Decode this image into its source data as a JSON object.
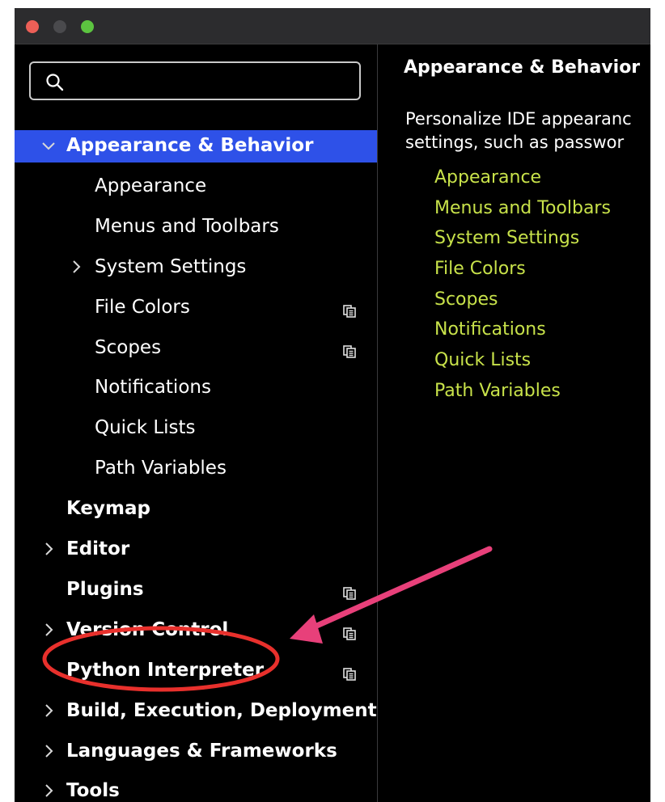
{
  "search": {
    "placeholder": "",
    "value": ""
  },
  "sidebar": {
    "items": [
      {
        "label": "Appearance & Behavior",
        "level": 1,
        "expanded": true,
        "selected": true,
        "project": false
      },
      {
        "label": "Appearance",
        "level": 2,
        "project": false
      },
      {
        "label": "Menus and Toolbars",
        "level": 2,
        "project": false
      },
      {
        "label": "System Settings",
        "level": 2,
        "expandable": true,
        "project": false
      },
      {
        "label": "File Colors",
        "level": 2,
        "project": true
      },
      {
        "label": "Scopes",
        "level": 2,
        "project": true
      },
      {
        "label": "Notifications",
        "level": 2,
        "project": false
      },
      {
        "label": "Quick Lists",
        "level": 2,
        "project": false
      },
      {
        "label": "Path Variables",
        "level": 2,
        "project": false
      },
      {
        "label": "Keymap",
        "level": 1,
        "project": false
      },
      {
        "label": "Editor",
        "level": 1,
        "expandable": true,
        "project": false
      },
      {
        "label": "Plugins",
        "level": 1,
        "project": true
      },
      {
        "label": "Version Control",
        "level": 1,
        "expandable": true,
        "project": true
      },
      {
        "label": "Python Interpreter",
        "level": 1,
        "project": true,
        "highlighted": true
      },
      {
        "label": "Build, Execution, Deployment",
        "level": 1,
        "expandable": true,
        "project": false
      },
      {
        "label": "Languages & Frameworks",
        "level": 1,
        "expandable": true,
        "project": false
      },
      {
        "label": "Tools",
        "level": 1,
        "expandable": true,
        "project": false
      }
    ]
  },
  "content": {
    "title": "Appearance & Behavior",
    "description_line1": "Personalize IDE appearanc",
    "description_line2": "settings, such as passwor",
    "links": [
      "Appearance",
      "Menus and Toolbars",
      "System Settings",
      "File Colors",
      "Scopes",
      "Notifications",
      "Quick Lists",
      "Path Variables"
    ]
  },
  "colors": {
    "selection": "#2e51e8",
    "link": "#c8e24a",
    "annotation": "#e8407a",
    "traffic_close": "#ec5f57",
    "traffic_zoom": "#5cc440"
  },
  "icons": {
    "search": "search-icon",
    "chevron_down": "chevron-down-icon",
    "chevron_right": "chevron-right-icon",
    "project": "project-level-icon"
  }
}
